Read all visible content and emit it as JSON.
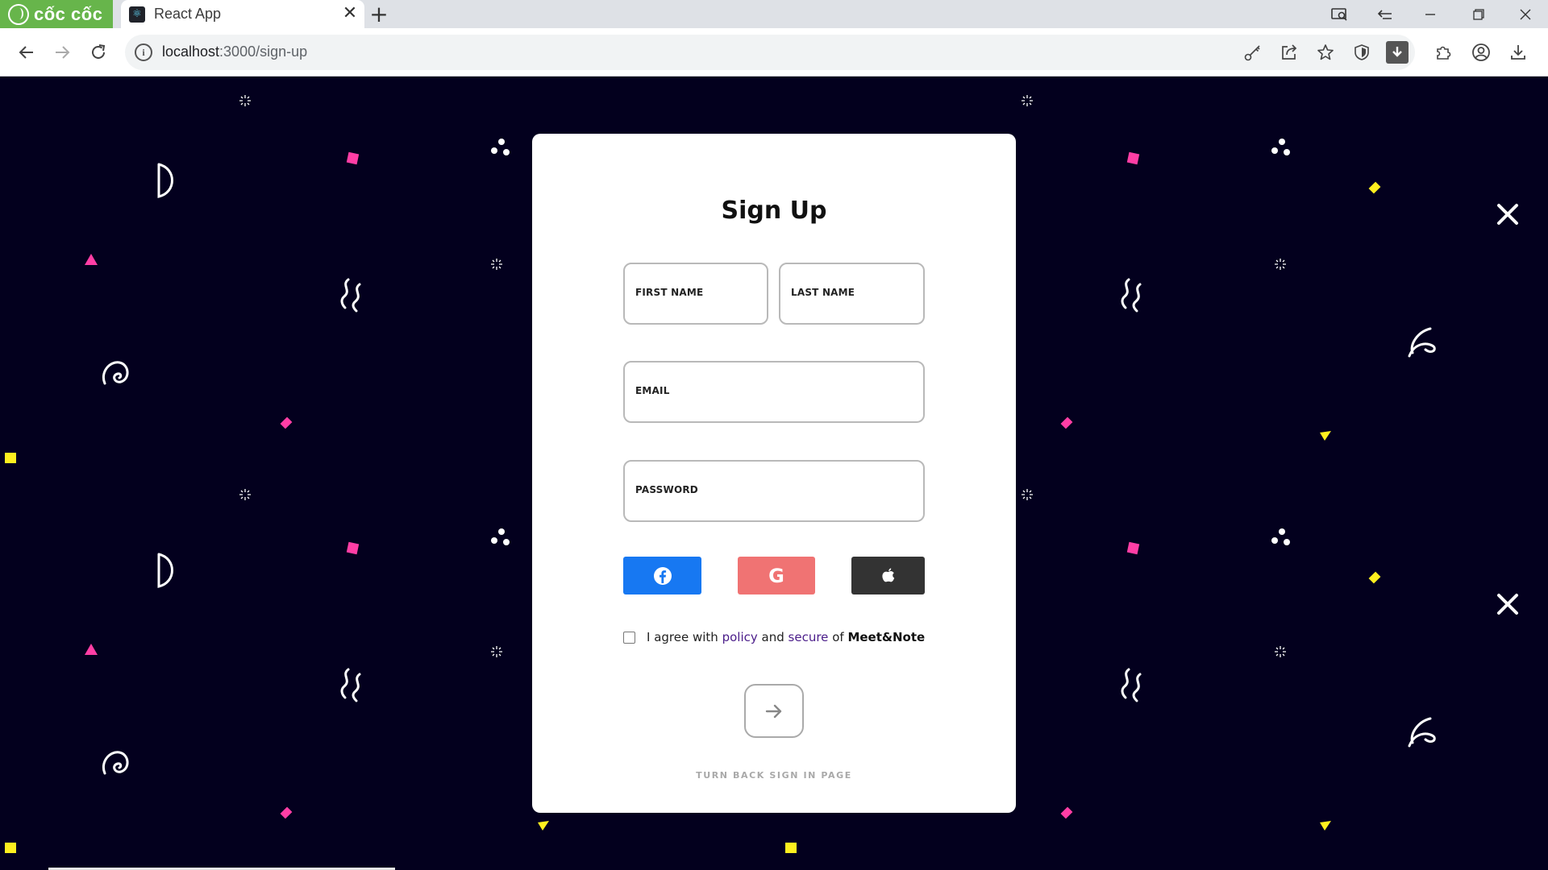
{
  "browser": {
    "brand": "cốc cốc",
    "tab_title": "React App",
    "url_host": "localhost",
    "url_rest": ":3000/sign-up",
    "new_tab_symbol": "+",
    "tab_close_symbol": "✕",
    "colors": {
      "brand": "#67b54b",
      "tabbar": "#dee1e6"
    }
  },
  "signup": {
    "title": "Sign Up",
    "first_name_label": "FIRST NAME",
    "last_name_label": "LAST NAME",
    "email_label": "EMAIL",
    "password_label": "PASSWORD",
    "social": {
      "facebook_icon": "facebook-icon",
      "google_icon": "google-icon",
      "apple_icon": "apple-icon",
      "google_letter": "G",
      "colors": {
        "facebook": "#1778f2",
        "google": "#f07373",
        "apple": "#333333"
      }
    },
    "agree": {
      "text1": "I agree with",
      "policy": "policy",
      "text2": "and",
      "secure": "secure",
      "text3": "of",
      "brand": "Meet&Note",
      "checked": false
    },
    "submit_icon": "arrow-right-icon",
    "back_link": "TURN BACK SIGN IN PAGE"
  },
  "background_colors": {
    "page": "#03001e",
    "pink": "#ff3ea5",
    "yellow": "#fff01f",
    "white": "#ffffff"
  }
}
